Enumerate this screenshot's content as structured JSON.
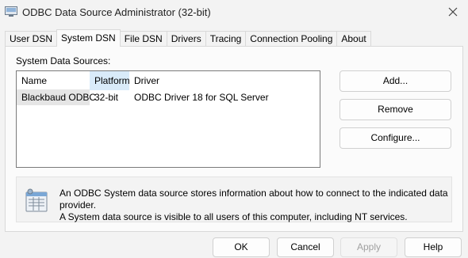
{
  "window": {
    "title": "ODBC Data Source Administrator (32-bit)"
  },
  "tabs": [
    {
      "label": "User DSN",
      "active": false
    },
    {
      "label": "System DSN",
      "active": true
    },
    {
      "label": "File DSN",
      "active": false
    },
    {
      "label": "Drivers",
      "active": false
    },
    {
      "label": "Tracing",
      "active": false
    },
    {
      "label": "Connection Pooling",
      "active": false
    },
    {
      "label": "About",
      "active": false
    }
  ],
  "system_dsn": {
    "section_label": "System Data Sources:",
    "columns": [
      "Name",
      "Platform",
      "Driver"
    ],
    "sorted_column": "Platform",
    "rows": [
      {
        "name": "Blackbaud ODBC",
        "platform": "32-bit",
        "driver": "ODBC Driver 18 for SQL Server"
      }
    ],
    "buttons": {
      "add": "Add...",
      "remove": "Remove",
      "configure": "Configure..."
    },
    "info_line1": "An ODBC System data source stores information about how to connect to the indicated data provider.",
    "info_line2": "A System data source is visible to all users of this computer, including NT services."
  },
  "footer": {
    "ok": "OK",
    "cancel": "Cancel",
    "apply": "Apply",
    "help": "Help"
  }
}
